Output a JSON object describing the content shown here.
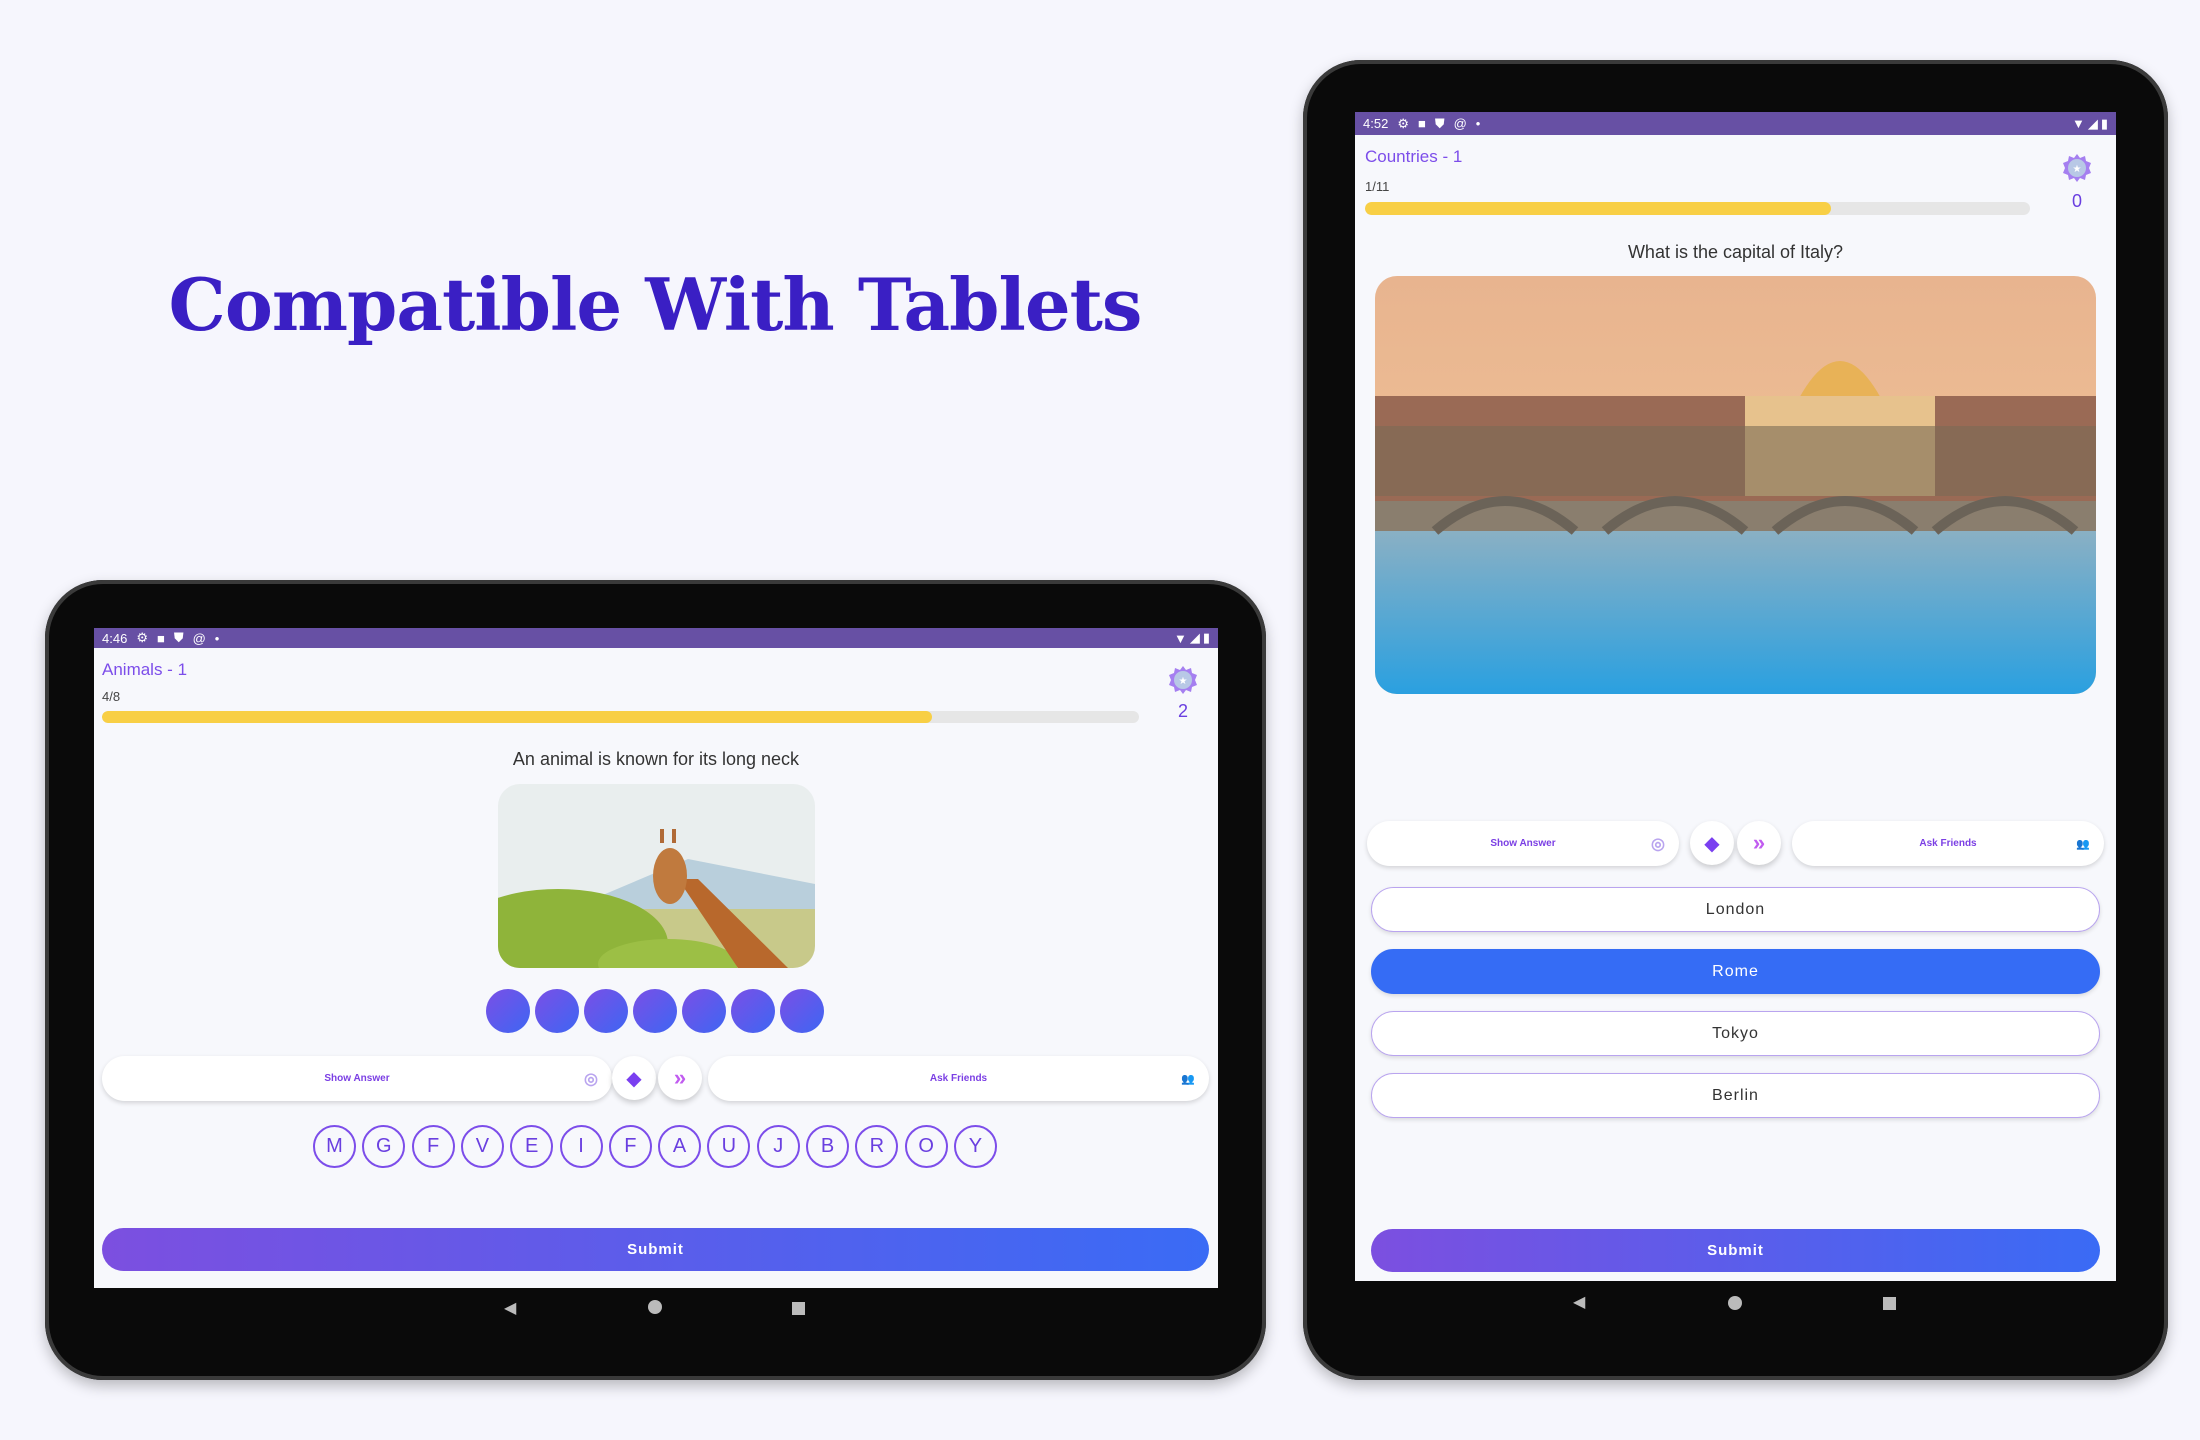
{
  "headline": "Compatible With Tablets",
  "colors": {
    "accent": "#7c4dea",
    "status_bar": "#6750a4",
    "progress": "#f8cf45",
    "selected": "#356cf5",
    "headline": "#3a1fc4"
  },
  "left_tablet": {
    "status_time": "4:46",
    "level": "Animals - 1",
    "progress_text": "4/8",
    "progress_fraction": 0.8,
    "score": "2",
    "question": "An animal is known for its long neck",
    "answer_slots": 7,
    "show_answer": "Show Answer",
    "ask_friends": "Ask Friends",
    "letters": [
      "M",
      "G",
      "F",
      "V",
      "E",
      "I",
      "F",
      "A",
      "U",
      "J",
      "B",
      "R",
      "O",
      "Y"
    ],
    "submit": "Submit"
  },
  "right_tablet": {
    "status_time": "4:52",
    "level": "Countries - 1",
    "progress_text": "1/11",
    "progress_fraction": 0.7,
    "score": "0",
    "question": "What is the capital of Italy?",
    "show_answer": "Show Answer",
    "ask_friends": "Ask Friends",
    "options": [
      "London",
      "Rome",
      "Tokyo",
      "Berlin"
    ],
    "selected_option": "Rome",
    "submit": "Submit"
  }
}
